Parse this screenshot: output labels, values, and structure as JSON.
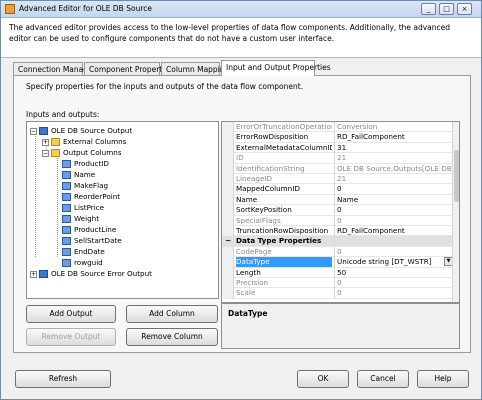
{
  "window": {
    "title": "Advanced Editor for OLE DB Source"
  },
  "titlebar_buttons": {
    "minimize": "_",
    "maximize": "□",
    "close": "×"
  },
  "description": "The advanced editor provides access to the low-level properties of data flow components. Additionally, the advanced editor can be used to configure components that do not have a custom user interface.",
  "tabs": [
    {
      "label": "Connection Managers"
    },
    {
      "label": "Component Properties"
    },
    {
      "label": "Column Mappings"
    },
    {
      "label": "Input and Output Properties"
    }
  ],
  "panel": {
    "description": "Specify properties for the inputs and outputs of the data flow component.",
    "io_label": "Inputs and outputs:"
  },
  "tree": {
    "root_output": "OLE DB Source Output",
    "external_columns": "External Columns",
    "output_columns": "Output Columns",
    "columns": [
      "ProductID",
      "Name",
      "MakeFlag",
      "ReorderPoint",
      "ListPrice",
      "Weight",
      "ProductLine",
      "SellStartDate",
      "EndDate",
      "rowguid"
    ],
    "error_output": "OLE DB Source Error Output"
  },
  "buttons": {
    "add_output": "Add Output",
    "add_column": "Add Column",
    "remove_output": "Remove Output",
    "remove_column": "Remove Column",
    "refresh": "Refresh",
    "ok": "OK",
    "cancel": "Cancel",
    "help": "Help"
  },
  "properties": [
    {
      "name": "ErrorOrTruncationOperation",
      "value": "Conversion",
      "readonly": true
    },
    {
      "name": "ErrorRowDisposition",
      "value": "RD_FailComponent",
      "readonly": false
    },
    {
      "name": "ExternalMetadataColumnID",
      "value": "31",
      "readonly": false
    },
    {
      "name": "ID",
      "value": "21",
      "readonly": true
    },
    {
      "name": "IdentificationString",
      "value": "OLE DB Source.Outputs[OLE DB Source",
      "readonly": true
    },
    {
      "name": "LineageID",
      "value": "21",
      "readonly": true
    },
    {
      "name": "MappedColumnID",
      "value": "0",
      "readonly": false
    },
    {
      "name": "Name",
      "value": "Name",
      "readonly": false
    },
    {
      "name": "SortKeyPosition",
      "value": "0",
      "readonly": false
    },
    {
      "name": "SpecialFlags",
      "value": "0",
      "readonly": true
    },
    {
      "name": "TruncationRowDisposition",
      "value": "RD_FailComponent",
      "readonly": false
    }
  ],
  "category": "Data Type Properties",
  "datatype_properties": [
    {
      "name": "CodePage",
      "value": "0",
      "readonly": true
    },
    {
      "name": "DataType",
      "value": "Unicode string [DT_WSTR]",
      "readonly": false,
      "selected": true
    },
    {
      "name": "Length",
      "value": "50",
      "readonly": false
    },
    {
      "name": "Precision",
      "value": "0",
      "readonly": true
    },
    {
      "name": "Scale",
      "value": "0",
      "readonly": true
    }
  ],
  "info": {
    "title": "DataType"
  }
}
